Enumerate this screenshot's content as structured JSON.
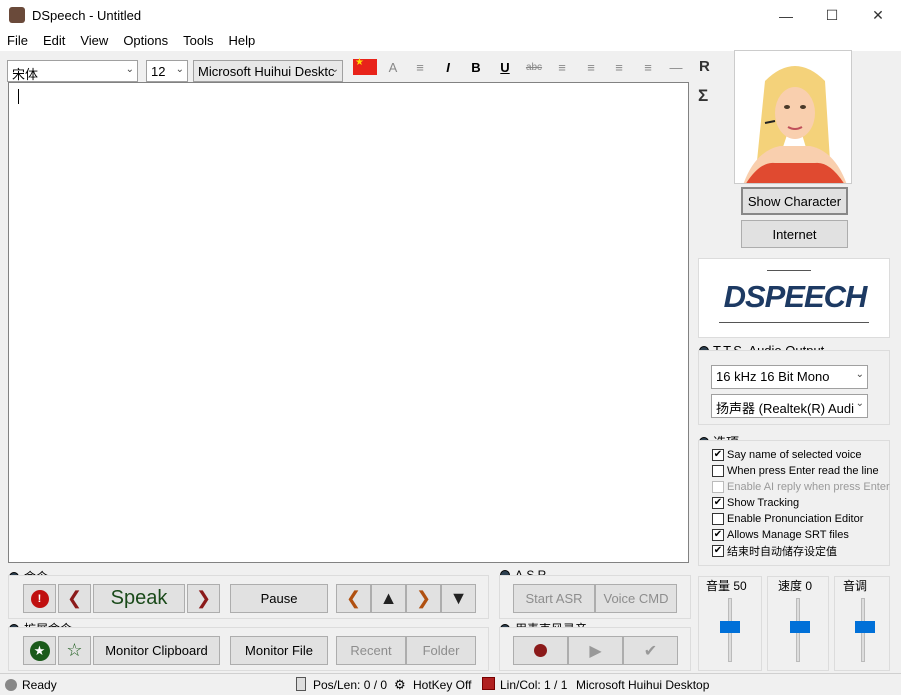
{
  "window": {
    "title": "DSpeech - Untitled"
  },
  "menu": [
    "File",
    "Edit",
    "View",
    "Options",
    "Tools",
    "Help"
  ],
  "toolbar": {
    "font_value": "宋体",
    "size_value": "12",
    "voice_value": "Microsoft Huihui Desktc"
  },
  "side": {
    "r_label": "R",
    "sigma_label": "Σ",
    "show_character": "Show Character",
    "internet": "Internet",
    "logo_text": "DSPEECH"
  },
  "tts": {
    "label": "T.T.S. Audio Output",
    "format": "16 kHz 16 Bit Mono",
    "device": "扬声器 (Realtek(R) Audi"
  },
  "options": {
    "label": "选项",
    "items": [
      {
        "label": "Say name of selected voice",
        "checked": true,
        "enabled": true
      },
      {
        "label": "When press Enter read the line",
        "checked": false,
        "enabled": true
      },
      {
        "label": "Enable AI reply when press Enter",
        "checked": false,
        "enabled": false
      },
      {
        "label": "Show Tracking",
        "checked": true,
        "enabled": true
      },
      {
        "label": "Enable Pronunciation Editor",
        "checked": false,
        "enabled": true
      },
      {
        "label": "Allows Manage SRT files",
        "checked": true,
        "enabled": true
      },
      {
        "label": "结束时自动储存设定值",
        "checked": true,
        "enabled": true
      }
    ]
  },
  "sliders": {
    "volume_label": "音量 50",
    "speed_label": "速度 0",
    "pitch_label": "音调",
    "volume": 50,
    "speed": 0
  },
  "commands": {
    "label": "命令",
    "speak": "Speak",
    "pause": "Pause"
  },
  "ext": {
    "label": "扩展命令",
    "monitor_clipboard": "Monitor Clipboard",
    "monitor_file": "Monitor File",
    "recent": "Recent",
    "folder": "Folder"
  },
  "asr": {
    "label": "A.S.R.",
    "start": "Start ASR",
    "voice_cmd": "Voice CMD"
  },
  "mic": {
    "label": "用麦克风录音"
  },
  "status": {
    "ready": "Ready",
    "pos": "Pos/Len: 0 / 0",
    "hotkey": "HotKey Off",
    "lincol": "Lin/Col: 1 / 1",
    "voice": "Microsoft Huihui Desktop"
  }
}
